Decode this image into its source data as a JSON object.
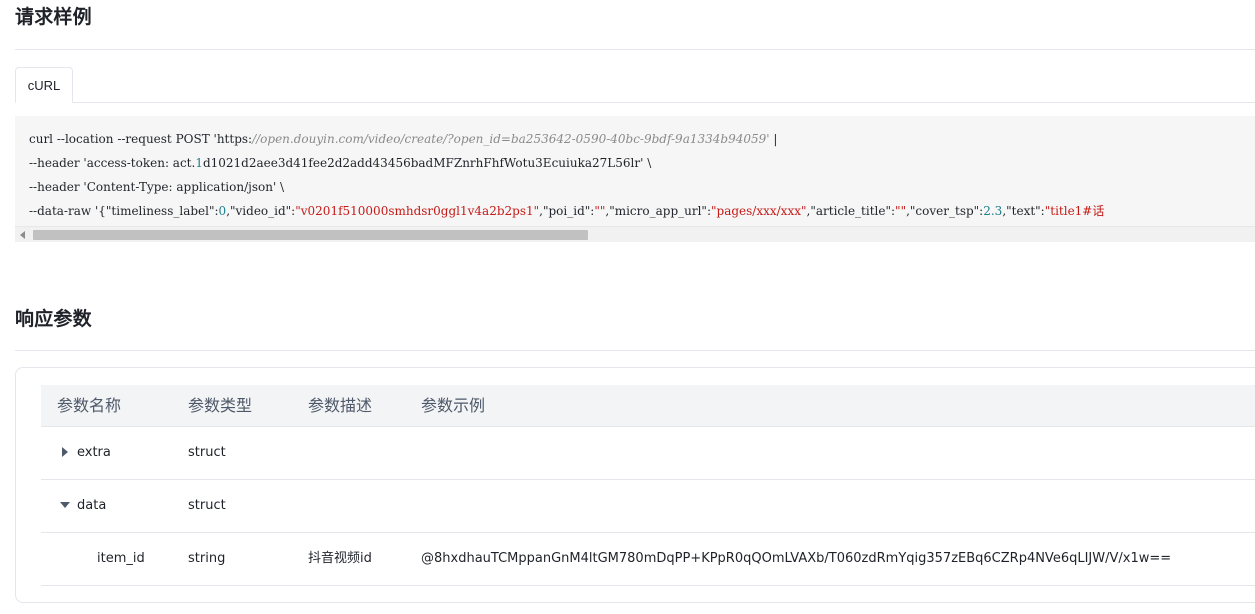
{
  "request_section": {
    "title": "请求样例",
    "tabs": [
      {
        "label": "cURL",
        "active": true
      }
    ],
    "code": {
      "line1_prefix": "curl --location --request POST 'https:",
      "line1_url": "//open.douyin.com/video/create/?open_id=ba253642-0590-40bc-9bdf-9a1334b94059'",
      "line1_suffix": " |",
      "line2_prefix": "--header 'access-token: act.",
      "line2_num": "1",
      "line2_token": "d1021d2aee3d41fee2d2add43456badMFZnrhFhfWotu3Ecuiuka27L56lr' \\",
      "line3": "--header 'Content-Type: application/json' \\",
      "line4_part1": "--data-raw '{\"timeliness_label\":",
      "line4_num1": "0",
      "line4_part2": ",\"video_id\":",
      "line4_video_id": "\"v0201f510000smhdsr0ggl1v4a2b2ps1\"",
      "line4_part3": ",\"poi_id\":",
      "line4_poi_id": "\"\"",
      "line4_part4": ",\"micro_app_url\":",
      "line4_micro_app_url": "\"pages/xxx/xxx\"",
      "line4_part5": ",\"article_title\":",
      "line4_article_title": "\"\"",
      "line4_part6": ",\"cover_tsp\":",
      "line4_cover_tsp": "2.3",
      "line4_part7": ",\"text\":",
      "line4_text": "\"title1#话"
    }
  },
  "response_section": {
    "title": "响应参数",
    "table": {
      "headers": [
        "参数名称",
        "参数类型",
        "参数描述",
        "参数示例"
      ],
      "rows": [
        {
          "name": "extra",
          "type": "struct",
          "description": "",
          "example": "",
          "expand_state": "collapsed"
        },
        {
          "name": "data",
          "type": "struct",
          "description": "",
          "example": "",
          "expand_state": "expanded"
        },
        {
          "name": "item_id",
          "type": "string",
          "description": "抖音视频id",
          "example": "@8hxdhauTCMppanGnM4ltGM780mDqPP+KPpR0qQOmLVAXb/T060zdRmYqig357zEBq6CZRp4NVe6qLIJW/V/x1w=="
        }
      ]
    }
  },
  "icons": {
    "collapsed_row": "chevron-right-icon",
    "expanded_row": "chevron-down-icon",
    "scroll_left": "scroll-left-icon"
  },
  "colors": {
    "divider": "#e5e6eb",
    "code_background": "#f6f6f6",
    "table_header_background": "#f3f4f6",
    "string_value": "#c41a16",
    "number_value": "#1b7f8c"
  }
}
